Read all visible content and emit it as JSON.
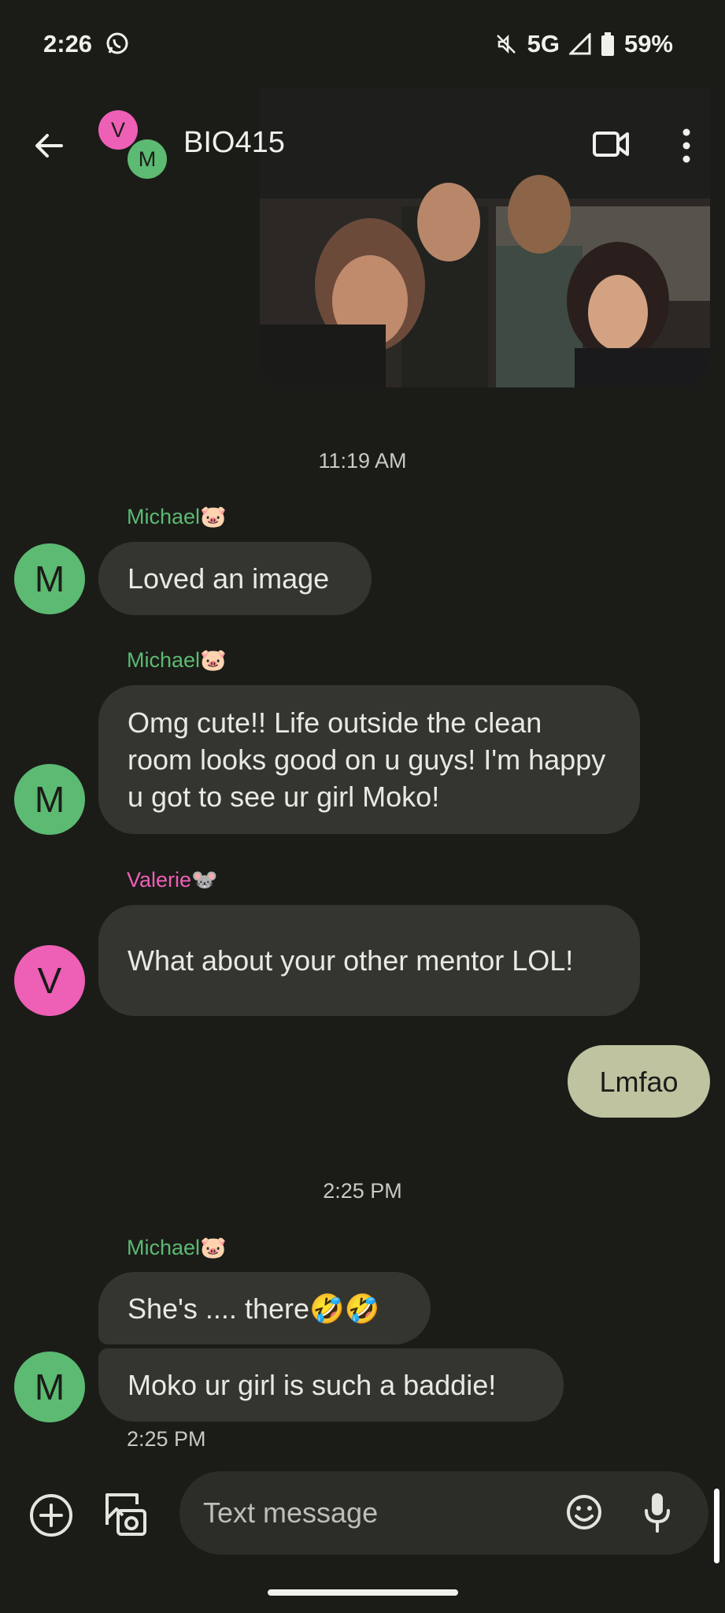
{
  "status_bar": {
    "time": "2:26",
    "network": "5G",
    "battery": "59%"
  },
  "header": {
    "title": "BIO415",
    "avatar_v": "V",
    "avatar_m": "M"
  },
  "colors": {
    "michael": "#5cba72",
    "valerie": "#ee5fb6",
    "background": "#1b1c18",
    "bubble": "#34352f",
    "mine": "#bfc3a0"
  },
  "messages": {
    "time1": "11:19 AM",
    "m1_sender": "Michael🐷",
    "m1_text": "Loved an image",
    "m2_sender": "Michael🐷",
    "m2_text": "Omg cute!! Life outside the clean room looks good on u guys! I'm happy u got to see ur girl Moko!",
    "m3_sender": "Valerie🐭",
    "m3_text": "What about your other mentor LOL!",
    "mine_text": "Lmfao",
    "time2": "2:25 PM",
    "m4_sender": "Michael🐷",
    "m4_text": "She's .... there🤣🤣",
    "m5_text": "Moko ur girl is such a baddie!",
    "m5_time": "2:25 PM",
    "avatar_m": "M",
    "avatar_v": "V"
  },
  "composer": {
    "placeholder": "Text message"
  }
}
